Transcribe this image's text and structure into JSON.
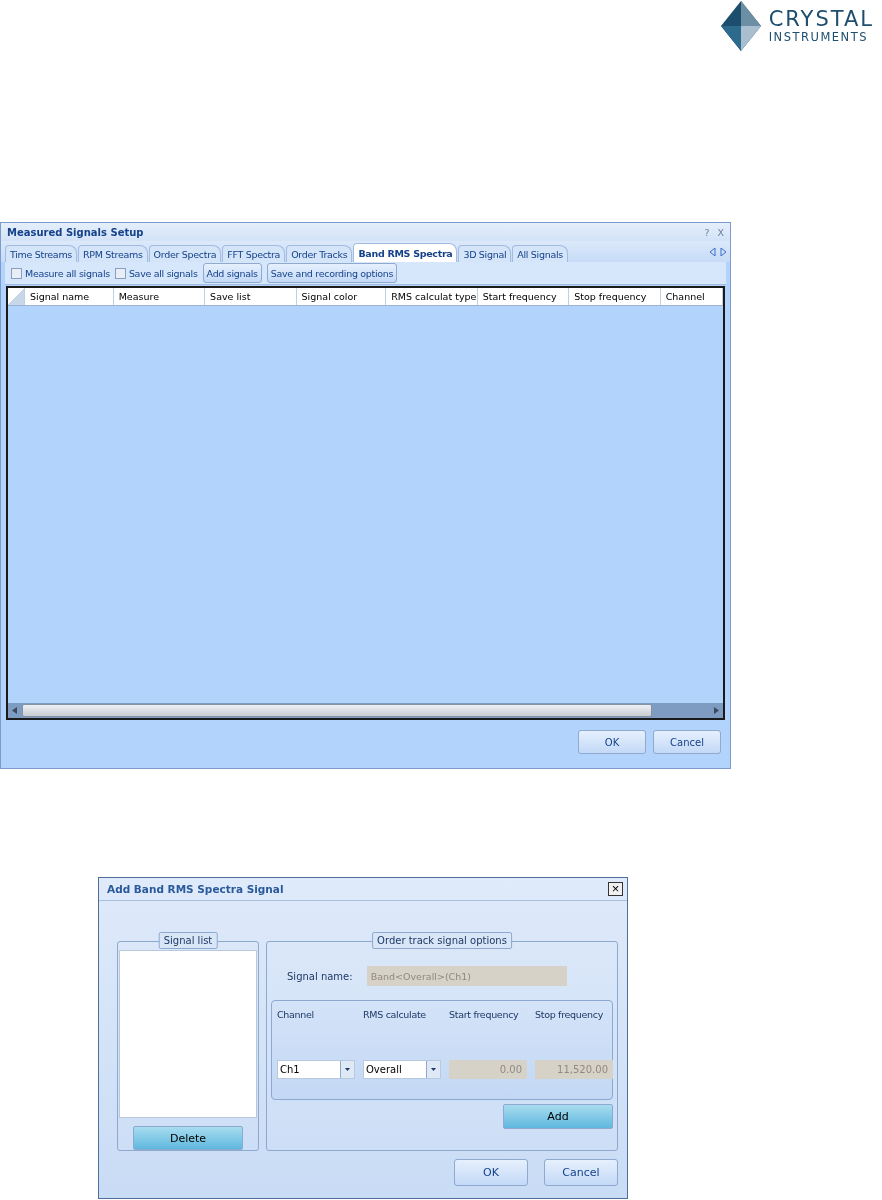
{
  "logo": {
    "line_1": "CRYSTAL",
    "line_2": "INSTRUMENTS"
  },
  "setup_dialog": {
    "title": "Measured Signals Setup",
    "help": "?",
    "close": "X",
    "tabs": [
      {
        "label": "Time Streams",
        "selected": false
      },
      {
        "label": "RPM Streams",
        "selected": false
      },
      {
        "label": "Order Spectra",
        "selected": false
      },
      {
        "label": "FFT Spectra",
        "selected": false
      },
      {
        "label": "Order Tracks",
        "selected": false
      },
      {
        "label": "Band RMS Spectra",
        "selected": true
      },
      {
        "label": "3D Signal",
        "selected": false
      },
      {
        "label": "All Signals",
        "selected": false
      }
    ],
    "toolbar": [
      {
        "kind": "checkbox",
        "label": "Measure all signals",
        "checked": false
      },
      {
        "kind": "checkbox",
        "label": "Save all signals",
        "checked": false
      },
      {
        "kind": "button",
        "label": "Add signals"
      },
      {
        "kind": "button",
        "label": "Save and recording options"
      }
    ],
    "columns": [
      "Signal name",
      "Measure",
      "Save list",
      "Signal color",
      "RMS calculat type",
      "Start frequency",
      "Stop frequency",
      "Channel"
    ],
    "buttons": [
      "OK",
      "Cancel"
    ]
  },
  "add_dialog": {
    "title": "Add Band RMS Spectra Signal",
    "close": "×",
    "signal_list": {
      "legend": "Signal list",
      "delete_button": "Delete"
    },
    "options": {
      "legend": "Order track signal options",
      "signal_name_label": "Signal name:",
      "signal_name": "Band<Overall>(Ch1)",
      "fields": [
        {
          "kind": "dropdown",
          "label": "Channel",
          "value": "Ch1",
          "disabled": false
        },
        {
          "kind": "dropdown",
          "label": "RMS calculate",
          "value": "Overall",
          "disabled": false
        },
        {
          "kind": "number",
          "label": "Start frequency",
          "value": "0.00",
          "disabled": true
        },
        {
          "kind": "number",
          "label": "Stop frequency",
          "value": "11,520.00",
          "disabled": true
        }
      ],
      "add_button": "Add"
    },
    "buttons": [
      "OK",
      "Cancel"
    ]
  }
}
